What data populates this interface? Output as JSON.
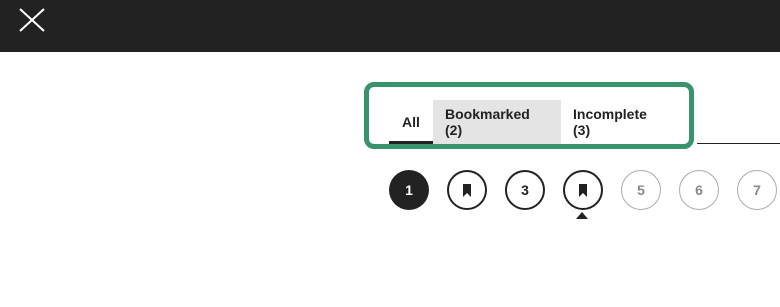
{
  "header": {
    "close_icon": "close-icon"
  },
  "tabs": [
    {
      "label": "All"
    },
    {
      "label": "Bookmarked (2)"
    },
    {
      "label": "Incomplete (3)"
    }
  ],
  "pages": [
    {
      "label": "1",
      "state": "current"
    },
    {
      "label": "",
      "state": "bookmarked",
      "icon": "bookmark-icon"
    },
    {
      "label": "3",
      "state": "answered"
    },
    {
      "label": "",
      "state": "bookmarked",
      "icon": "bookmark-icon"
    },
    {
      "label": "5",
      "state": "unanswered"
    },
    {
      "label": "6",
      "state": "unanswered"
    },
    {
      "label": "7",
      "state": "unanswered"
    }
  ],
  "colors": {
    "topbar": "#222222",
    "highlight": "#3a946b",
    "selected_tab_bg": "#e4e4e4"
  }
}
